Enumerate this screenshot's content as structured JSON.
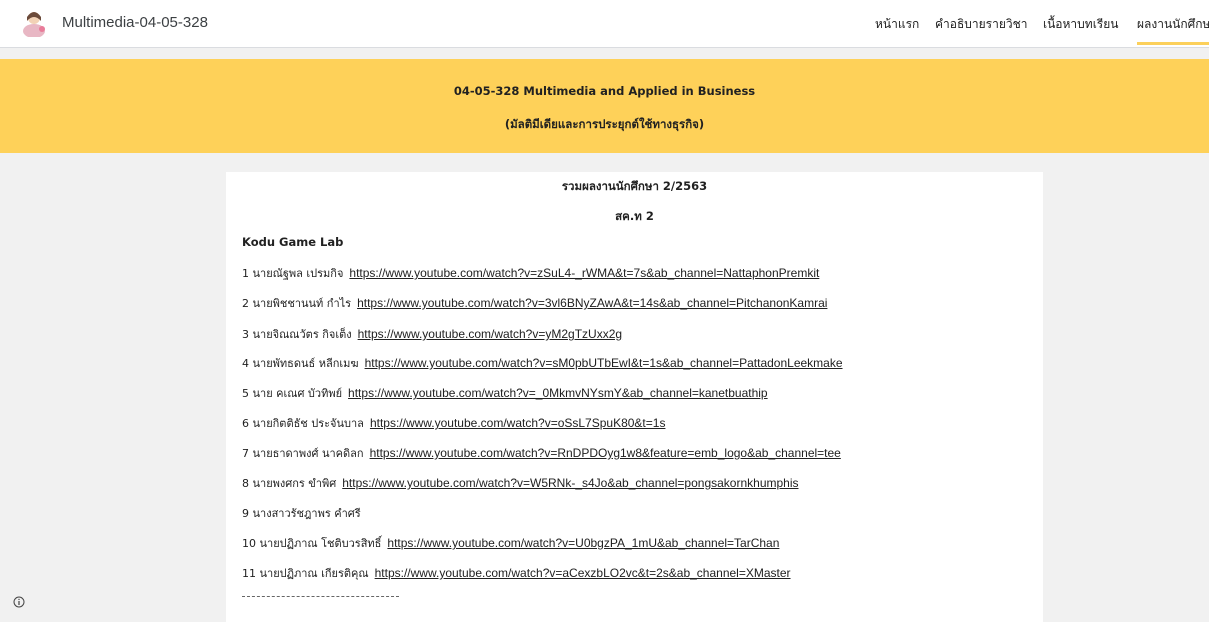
{
  "header": {
    "site_title": "Multimedia-04-05-328",
    "nav": [
      {
        "label": "หน้าแรก"
      },
      {
        "label": "คำอธิบายรายวิชา"
      },
      {
        "label": "เนื้อหาบทเรียน"
      },
      {
        "label": "ผลงานนักศึกษ"
      }
    ]
  },
  "banner": {
    "title": "04-05-328  Multimedia and Applied in Business",
    "subtitle": "(มัลติมีเดียและการประยุกต์ใช้ทางธุรกิจ)"
  },
  "content": {
    "heading": "รวมผลงานนักศึกษา  2/2563",
    "section": "สค.ท 2",
    "subheading": "Kodu Game Lab",
    "entries": [
      {
        "who": "1 นายณัฐพล เปรมกิจ",
        "url": "https://www.youtube.com/watch?v=zSuL4-_rWMA&t=7s&ab_channel=NattaphonPremkit"
      },
      {
        "who": "2 นายพิชชานนท์ กำไร",
        "url": "https://www.youtube.com/watch?v=3vl6BNyZAwA&t=14s&ab_channel=PitchanonKamrai"
      },
      {
        "who": "3 นายจิณณวัตร กิจเต็ง",
        "url": "https://www.youtube.com/watch?v=yM2gTzUxx2g"
      },
      {
        "who": "4 นายพัทธดนธ์ หลีกเมฆ",
        "url": "https://www.youtube.com/watch?v=sM0pbUTbEwI&t=1s&ab_channel=PattadonLeekmake"
      },
      {
        "who": "5  นาย คเณศ บัวทิพย์",
        "url": "https://www.youtube.com/watch?v=_0MkmvNYsmY&ab_channel=kanetbuathip"
      },
      {
        "who": "6  นายกิตติธัช ประจันบาล",
        "url": "https://www.youtube.com/watch?v=oSsL7SpuK80&t=1s"
      },
      {
        "who": "7  นายธาดาพงศ์ นาคดิลก",
        "url": "https://www.youtube.com/watch?v=RnDPDOyg1w8&feature=emb_logo&ab_channel=tee"
      },
      {
        "who": "8  นายพงศกร ขำพิศ",
        "url": "https://www.youtube.com/watch?v=W5RNk-_s4Jo&ab_channel=pongsakornkhumphis"
      },
      {
        "who": "9   นางสาวรัชฎาพร คำศรี",
        "url": ""
      },
      {
        "who": "10  นายปฏิภาณ โชติบวรสิทธิ์",
        "url": "https://www.youtube.com/watch?v=U0bgzPA_1mU&ab_channel=TarChan"
      },
      {
        "who": "11  นายปฏิภาณ เกียรติคุณ",
        "url": "https://www.youtube.com/watch?v=aCexzbLO2vc&t=2s&ab_channel=XMaster"
      }
    ]
  },
  "colors": {
    "accent": "#fed159",
    "background": "#f1f1f1",
    "panel": "#ffffff"
  },
  "icons": {
    "logo": "avatar-logo",
    "footer": "info-icon"
  }
}
